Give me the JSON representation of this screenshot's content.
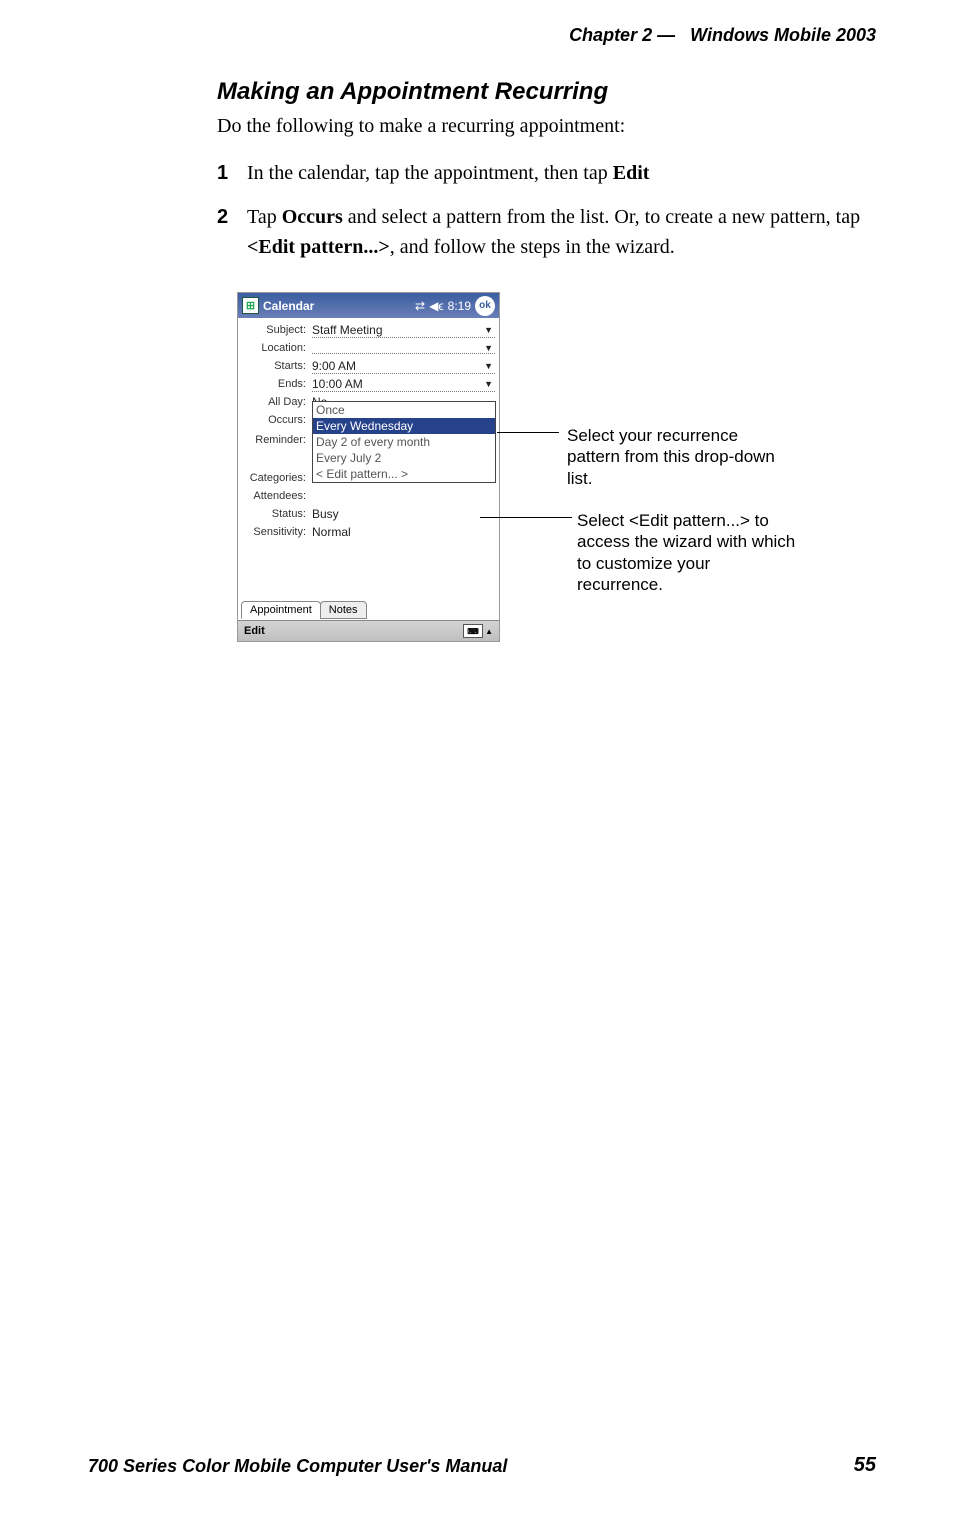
{
  "header": {
    "chapter_label": "Chapter 2",
    "sep": "—",
    "book_section": "Windows Mobile 2003"
  },
  "title": "Making an Appointment Recurring",
  "intro": "Do the following to make a recurring appointment:",
  "steps": {
    "s1_num": "1",
    "s1_a": "In the calendar, tap the appointment, then tap ",
    "s1_b": "Edit",
    "s2_num": "2",
    "s2_a": "Tap ",
    "s2_b": "Occurs",
    "s2_c": " and select a pattern from the list. Or, to create a new pattern, tap ",
    "s2_d": "<Edit pattern...>",
    "s2_e": ", and follow the steps in the wizard."
  },
  "pda": {
    "title": "Calendar",
    "time": "8:19",
    "ok": "ok",
    "fields": {
      "subject_lbl": "Subject:",
      "subject_val": "Staff Meeting",
      "location_lbl": "Location:",
      "location_val": "",
      "starts_lbl": "Starts:",
      "starts_val": "9:00 AM",
      "ends_lbl": "Ends:",
      "ends_val": "10:00 AM",
      "allday_lbl": "All Day:",
      "allday_val": "No",
      "occurs_lbl": "Occurs:",
      "occurs_val": "Every Wednesday",
      "reminder_lbl": "Reminder:",
      "categories_lbl": "Categories:",
      "attendees_lbl": "Attendees:",
      "status_lbl": "Status:",
      "status_val": "Busy",
      "sensitivity_lbl": "Sensitivity:",
      "sensitivity_val": "Normal"
    },
    "dropdown": {
      "opt1": "Once",
      "opt2": "Every Wednesday",
      "opt3": "Day 2 of every month",
      "opt4": "Every July 2",
      "opt5": "< Edit pattern... >"
    },
    "tabs": {
      "t1": "Appointment",
      "t2": "Notes"
    },
    "bottom": {
      "edit": "Edit"
    }
  },
  "callouts": {
    "c1": "Select your recurrence pattern from this drop-down list.",
    "c2": "Select <Edit pattern...> to access the wizard with which to customize your recurrence."
  },
  "footer": {
    "left": "700 Series Color Mobile Computer User's Manual",
    "page": "55"
  }
}
